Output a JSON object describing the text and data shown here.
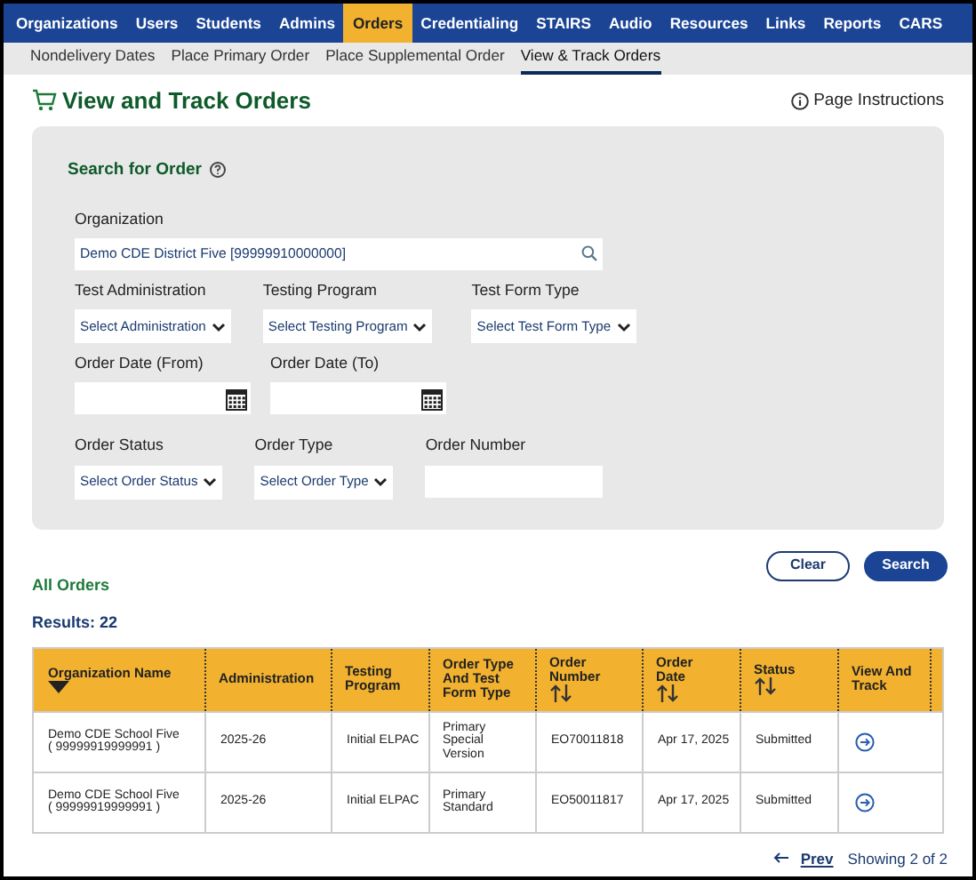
{
  "nav": [
    {
      "label": "Organizations",
      "selected": false
    },
    {
      "label": "Users",
      "selected": false
    },
    {
      "label": "Students",
      "selected": false
    },
    {
      "label": "Admins",
      "selected": false
    },
    {
      "label": "Orders",
      "selected": true
    },
    {
      "label": "Credentialing",
      "selected": false
    },
    {
      "label": "STAIRS",
      "selected": false
    },
    {
      "label": "Audio",
      "selected": false
    },
    {
      "label": "Resources",
      "selected": false
    },
    {
      "label": "Links",
      "selected": false
    },
    {
      "label": "Reports",
      "selected": false
    },
    {
      "label": "CARS",
      "selected": false
    }
  ],
  "subnav": [
    {
      "label": "Nondelivery Dates",
      "selected": false
    },
    {
      "label": "Place Primary Order",
      "selected": false
    },
    {
      "label": "Place Supplemental Order",
      "selected": false
    },
    {
      "label": "View & Track Orders",
      "selected": true
    }
  ],
  "page_title": "View and Track Orders",
  "page_instructions": "Page Instructions",
  "search_panel": {
    "title": "Search for Order",
    "organization": {
      "label": "Organization",
      "value": "Demo CDE District Five [99999910000000]"
    },
    "rows": [
      [
        {
          "kind": "select",
          "label": "Test Administration",
          "value": "Select Administration"
        },
        {
          "kind": "select",
          "label": "Testing Program",
          "value": "Select Testing Program"
        },
        {
          "kind": "select",
          "label": "Test Form Type",
          "value": "Select Test Form Type"
        }
      ],
      [
        {
          "kind": "date",
          "label": "Order Date (From)"
        },
        {
          "kind": "date",
          "label": "Order Date (To)"
        }
      ],
      [
        {
          "kind": "select",
          "label": "Order Status",
          "value": "Select Order Status"
        },
        {
          "kind": "select",
          "label": "Order Type",
          "value": "Select Order Type"
        },
        {
          "kind": "text",
          "label": "Order Number"
        }
      ]
    ]
  },
  "buttons": [
    {
      "label": "Clear",
      "kind": "secondary"
    },
    {
      "label": "Search",
      "kind": "primary"
    }
  ],
  "all_orders": "All Orders",
  "results": "Results: 22",
  "table": {
    "columns": [
      {
        "label": "Organization Name",
        "kind": "sorted"
      },
      {
        "label": "Administration",
        "kind": "plain"
      },
      {
        "label": "Testing Program",
        "kind": "plain"
      },
      {
        "label": "Order Type And Test Form Type",
        "kind": "plain"
      },
      {
        "label": "Order Number",
        "kind": "sortable"
      },
      {
        "label": "Order Date",
        "kind": "sortable"
      },
      {
        "label": "Status",
        "kind": "sortable"
      },
      {
        "label": "View And Track",
        "kind": "plain"
      }
    ],
    "rows": [
      [
        "Demo CDE School Five ( 99999919999991 )",
        "2025-26",
        "Initial ELPAC",
        "Primary Special Version",
        "EO70011818",
        "Apr 17, 2025",
        "Submitted"
      ],
      [
        "Demo CDE School Five ( 99999919999991 )",
        "2025-26",
        "Initial ELPAC",
        "Primary Standard",
        "EO50011817",
        "Apr 17, 2025",
        "Submitted"
      ]
    ]
  },
  "pager": {
    "prev": "Prev",
    "showing": "Showing 2 of 2"
  }
}
